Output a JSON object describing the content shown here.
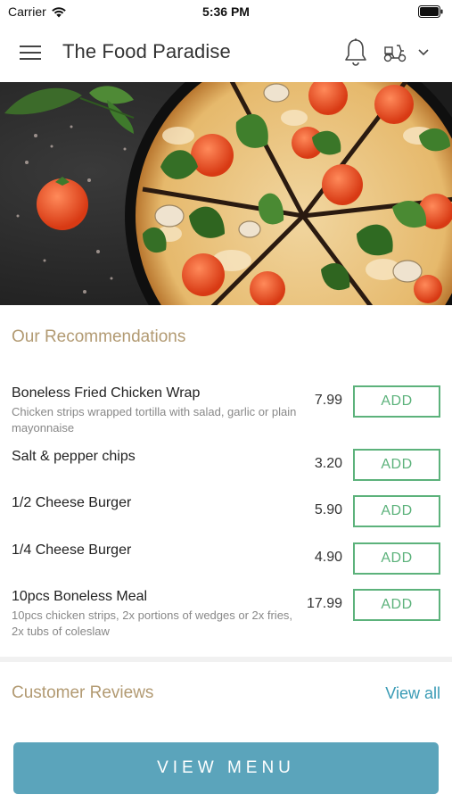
{
  "status_bar": {
    "carrier": "Carrier",
    "time": "5:36 PM"
  },
  "header": {
    "title": "The Food Paradise",
    "icons": {
      "menu": "hamburger-menu-icon",
      "notifications": "bell-icon",
      "delivery": "scooter-icon",
      "dropdown": "chevron-down-icon"
    }
  },
  "hero": {
    "image": "pizza-photo"
  },
  "recommendations": {
    "title": "Our Recommendations",
    "items": [
      {
        "name": "Boneless Fried Chicken Wrap",
        "description": "Chicken strips wrapped tortilla with salad, garlic or plain mayonnaise",
        "price": "7.99",
        "button": "ADD"
      },
      {
        "name": "Salt & pepper chips",
        "description": "",
        "price": "3.20",
        "button": "ADD"
      },
      {
        "name": "1/2 Cheese Burger",
        "description": "",
        "price": "5.90",
        "button": "ADD"
      },
      {
        "name": "1/4 Cheese Burger",
        "description": "",
        "price": "4.90",
        "button": "ADD"
      },
      {
        "name": "10pcs Boneless Meal",
        "description": "10pcs chicken strips, 2x portions of wedges or 2x fries, 2x tubs of coleslaw",
        "price": "17.99",
        "button": "ADD"
      }
    ]
  },
  "reviews": {
    "title": "Customer Reviews",
    "view_all": "View all"
  },
  "footer": {
    "view_menu": "VIEW MENU"
  },
  "colors": {
    "accent_green": "#5cb27b",
    "section_title": "#b29a72",
    "link_blue": "#3a9bb5",
    "button_teal": "#5ba4bb"
  }
}
